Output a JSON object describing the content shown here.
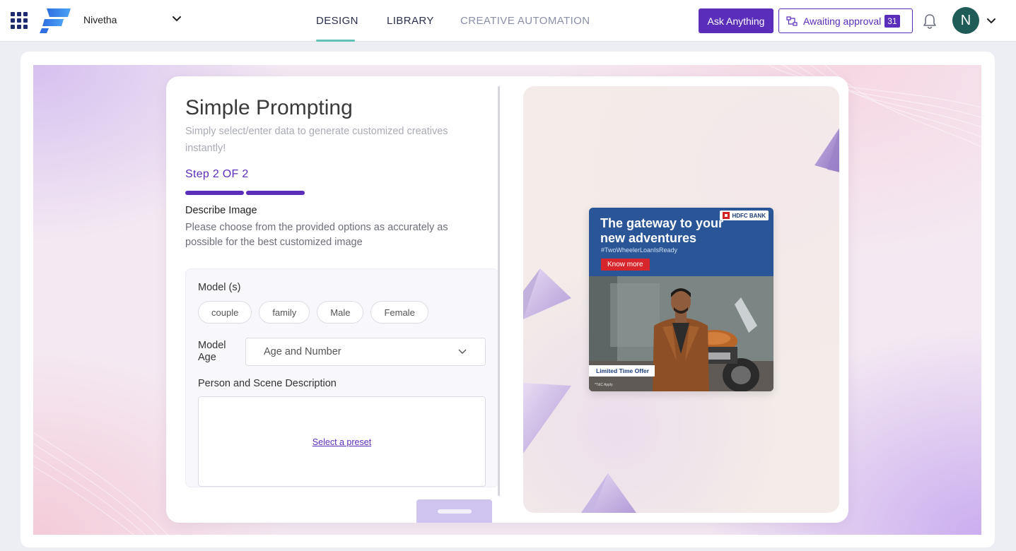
{
  "header": {
    "workspace": "Nivetha",
    "nav": {
      "design": "DESIGN",
      "library": "LIBRARY",
      "creative_automation": "CREATIVE AUTOMATION",
      "active": "DESIGN"
    },
    "ask_button": "Ask Anything",
    "approval_label": "Awaiting approval",
    "approval_count": "31",
    "avatar_initial": "N",
    "accent_color": "#5b2dbb"
  },
  "form": {
    "title": "Simple Prompting",
    "subtitle": "Simply select/enter data to generate customized creatives instantly!",
    "step": "Step 2 OF 2",
    "step_progress": 1.0,
    "describe_heading": "Describe Image",
    "describe_text": "Please choose from the provided options as accurately as possible for the best customized image",
    "model_label": "Model (s)",
    "model_options": [
      "couple",
      "family",
      "Male",
      "Female"
    ],
    "age_label": "Model Age",
    "age_value": "Age and Number",
    "scene_label": "Person and Scene Description",
    "preset_link": "Select a preset"
  },
  "preview": {
    "bank": "HDFC BANK",
    "headline": "The gateway to your new adventures",
    "hashtag": "#TwoWheelerLoanIsReady",
    "cta": "Know more",
    "offer": "Limited Time Offer",
    "tc": "*T&C Apply"
  }
}
